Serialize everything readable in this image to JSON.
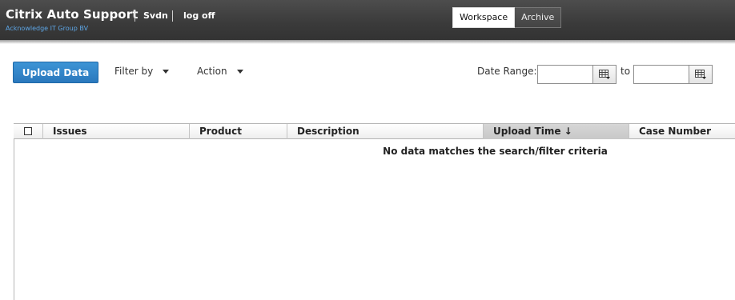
{
  "header": {
    "app_title": "Citrix Auto Support",
    "company": "Acknowledge IT Group BV",
    "user": "Svdn",
    "logoff": "log off",
    "tabs": [
      {
        "label": "Workspace",
        "active": true
      },
      {
        "label": "Archive",
        "active": false
      }
    ]
  },
  "toolbar": {
    "upload_label": "Upload Data",
    "filter_label": "Filter by",
    "action_label": "Action",
    "date_range_label": "Date Range:",
    "date_to_label": "to",
    "date_from_value": "",
    "date_to_value": ""
  },
  "grid": {
    "columns": [
      "Issues",
      "Product",
      "Description",
      "Upload Time ↓",
      "Case Number"
    ],
    "sorted_column": "Upload Time",
    "sort_direction": "descending",
    "empty_message": "No data matches the search/filter criteria"
  },
  "colors": {
    "header_bg": "#3a3a3a",
    "accent_blue": "#2a78bd",
    "company_text": "#5da6e6"
  }
}
